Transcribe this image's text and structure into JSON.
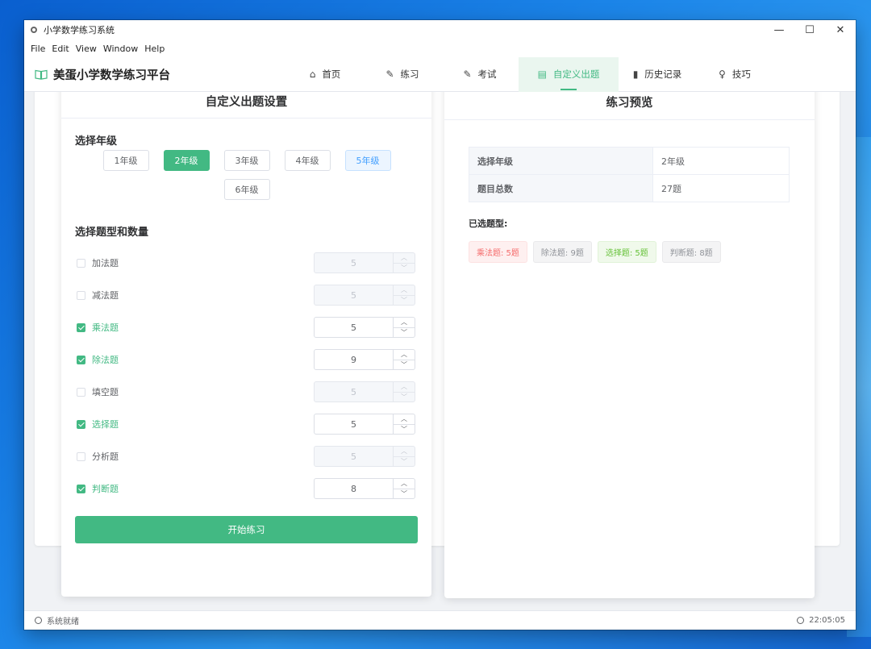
{
  "window": {
    "title": "小学数学练习系统",
    "controls": {
      "minimize": "—",
      "maximize": "☐",
      "close": "✕"
    }
  },
  "menu": [
    "File",
    "Edit",
    "View",
    "Window",
    "Help"
  ],
  "header": {
    "brand": "美蛋小学数学练习平台",
    "nav": [
      {
        "label": "首页",
        "icon": "home-icon",
        "glyph": "⌂"
      },
      {
        "label": "练习",
        "icon": "edit-icon",
        "glyph": "✎"
      },
      {
        "label": "考试",
        "icon": "edit-icon",
        "glyph": "✎"
      },
      {
        "label": "自定义出题",
        "icon": "document-icon",
        "glyph": "▤",
        "active": true
      },
      {
        "label": "历史记录",
        "icon": "bar-chart-icon",
        "glyph": "▮"
      },
      {
        "label": "技巧",
        "icon": "lightbulb-icon",
        "glyph": "♀"
      }
    ]
  },
  "settings": {
    "title": "自定义出题设置",
    "grade_label": "选择年级",
    "grades": [
      "1年级",
      "2年级",
      "3年级",
      "4年级",
      "5年级",
      "6年级"
    ],
    "selected_grade": "2年级",
    "hover_grade": "5年级",
    "types_label": "选择题型和数量",
    "questions": [
      {
        "label": "加法题",
        "checked": false,
        "count": "5"
      },
      {
        "label": "减法题",
        "checked": false,
        "count": "5"
      },
      {
        "label": "乘法题",
        "checked": true,
        "count": "5"
      },
      {
        "label": "除法题",
        "checked": true,
        "count": "9"
      },
      {
        "label": "填空题",
        "checked": false,
        "count": "5"
      },
      {
        "label": "选择题",
        "checked": true,
        "count": "5"
      },
      {
        "label": "分析题",
        "checked": false,
        "count": "5"
      },
      {
        "label": "判断题",
        "checked": true,
        "count": "8"
      }
    ],
    "start_button": "开始练习"
  },
  "preview": {
    "title": "练习预览",
    "rows": [
      {
        "key": "选择年级",
        "value": "2年级"
      },
      {
        "key": "题目总数",
        "value": "27题"
      }
    ],
    "selected_types_label": "已选题型:",
    "tags": [
      {
        "text": "乘法题: 5题",
        "style": "danger"
      },
      {
        "text": "除法题: 9题",
        "style": "info"
      },
      {
        "text": "选择题: 5题",
        "style": "success"
      },
      {
        "text": "判断题: 8题",
        "style": "info"
      }
    ]
  },
  "status": {
    "text": "系统就绪",
    "time": "22:05:05"
  },
  "colors": {
    "accent": "#42b983",
    "danger": "#f56c6c",
    "success": "#67c23a",
    "info": "#909399"
  }
}
